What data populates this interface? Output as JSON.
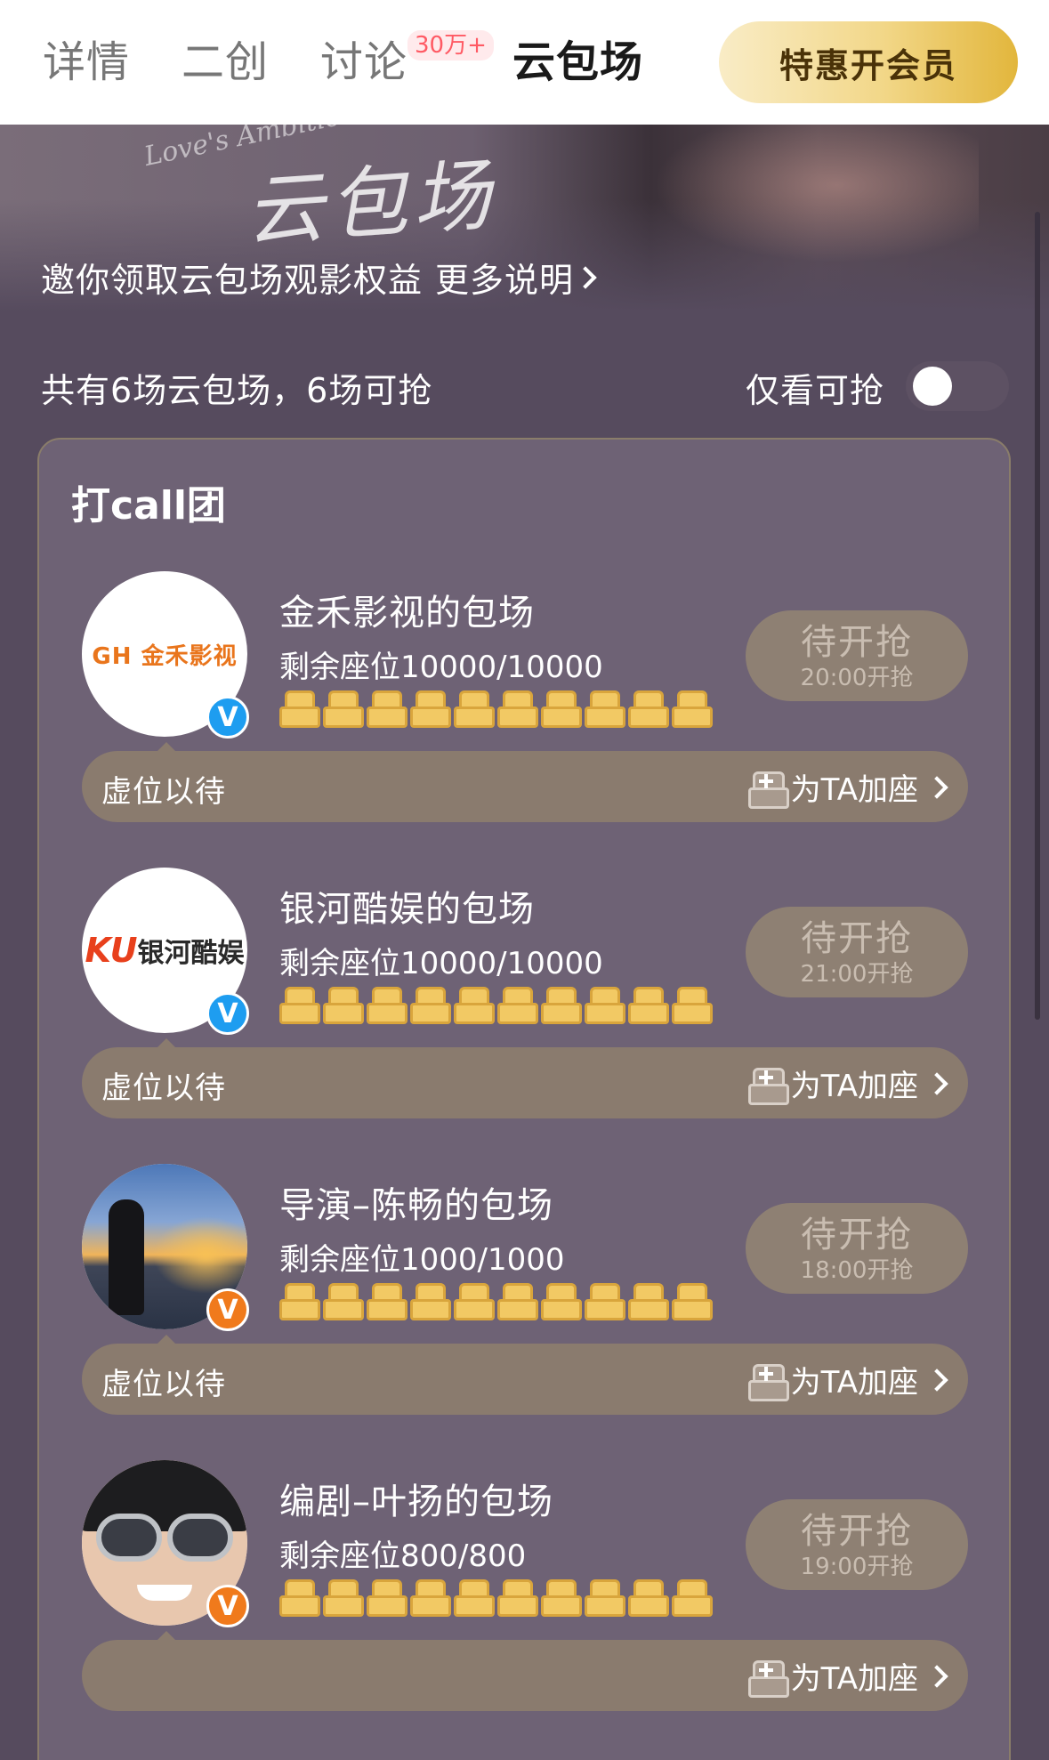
{
  "tabs": [
    {
      "label": "详情"
    },
    {
      "label": "二创"
    },
    {
      "label": "讨论",
      "badge": "30万+"
    },
    {
      "label": "云包场",
      "active": true
    }
  ],
  "vip_button": "特惠开会员",
  "banner": {
    "art_title": "云包场",
    "art_english": "Love's Ambition",
    "invite_text": "邀你领取云包场观影权益",
    "more_label": "更多说明"
  },
  "filter": {
    "summary": "共有6场云包场，6场可抢",
    "only_available_label": "仅看可抢",
    "only_available_on": false
  },
  "group_title": "打call团",
  "items": [
    {
      "title": "金禾影视的包场",
      "seats": "剩余座位10000/10000",
      "status": "待开抢",
      "time": "20:00开抢",
      "wait_text": "虚位以待",
      "add_seat": "为TA加座",
      "avatar_logo": "金禾影视",
      "avatar_logo_mark": "GH",
      "verified": "blue"
    },
    {
      "title": "银河酷娱的包场",
      "seats": "剩余座位10000/10000",
      "status": "待开抢",
      "time": "21:00开抢",
      "wait_text": "虚位以待",
      "add_seat": "为TA加座",
      "avatar_logo": "银河酷娱",
      "avatar_logo_mark": "KU",
      "verified": "blue"
    },
    {
      "title": "导演–陈畅的包场",
      "seats": "剩余座位1000/1000",
      "status": "待开抢",
      "time": "18:00开抢",
      "wait_text": "虚位以待",
      "add_seat": "为TA加座",
      "verified": "orange"
    },
    {
      "title": "编剧–叶扬的包场",
      "seats": "剩余座位800/800",
      "status": "待开抢",
      "time": "19:00开抢",
      "wait_text": "",
      "add_seat": "为TA加座",
      "verified": "orange"
    }
  ],
  "colors": {
    "background": "#564b5e",
    "card": "#6e6275",
    "seat_gold": "#f2c964",
    "vip_gold": "#e2b63c",
    "verified_blue": "#1e9df0",
    "verified_orange": "#f07a1c",
    "badge_red": "#ff5a64"
  }
}
